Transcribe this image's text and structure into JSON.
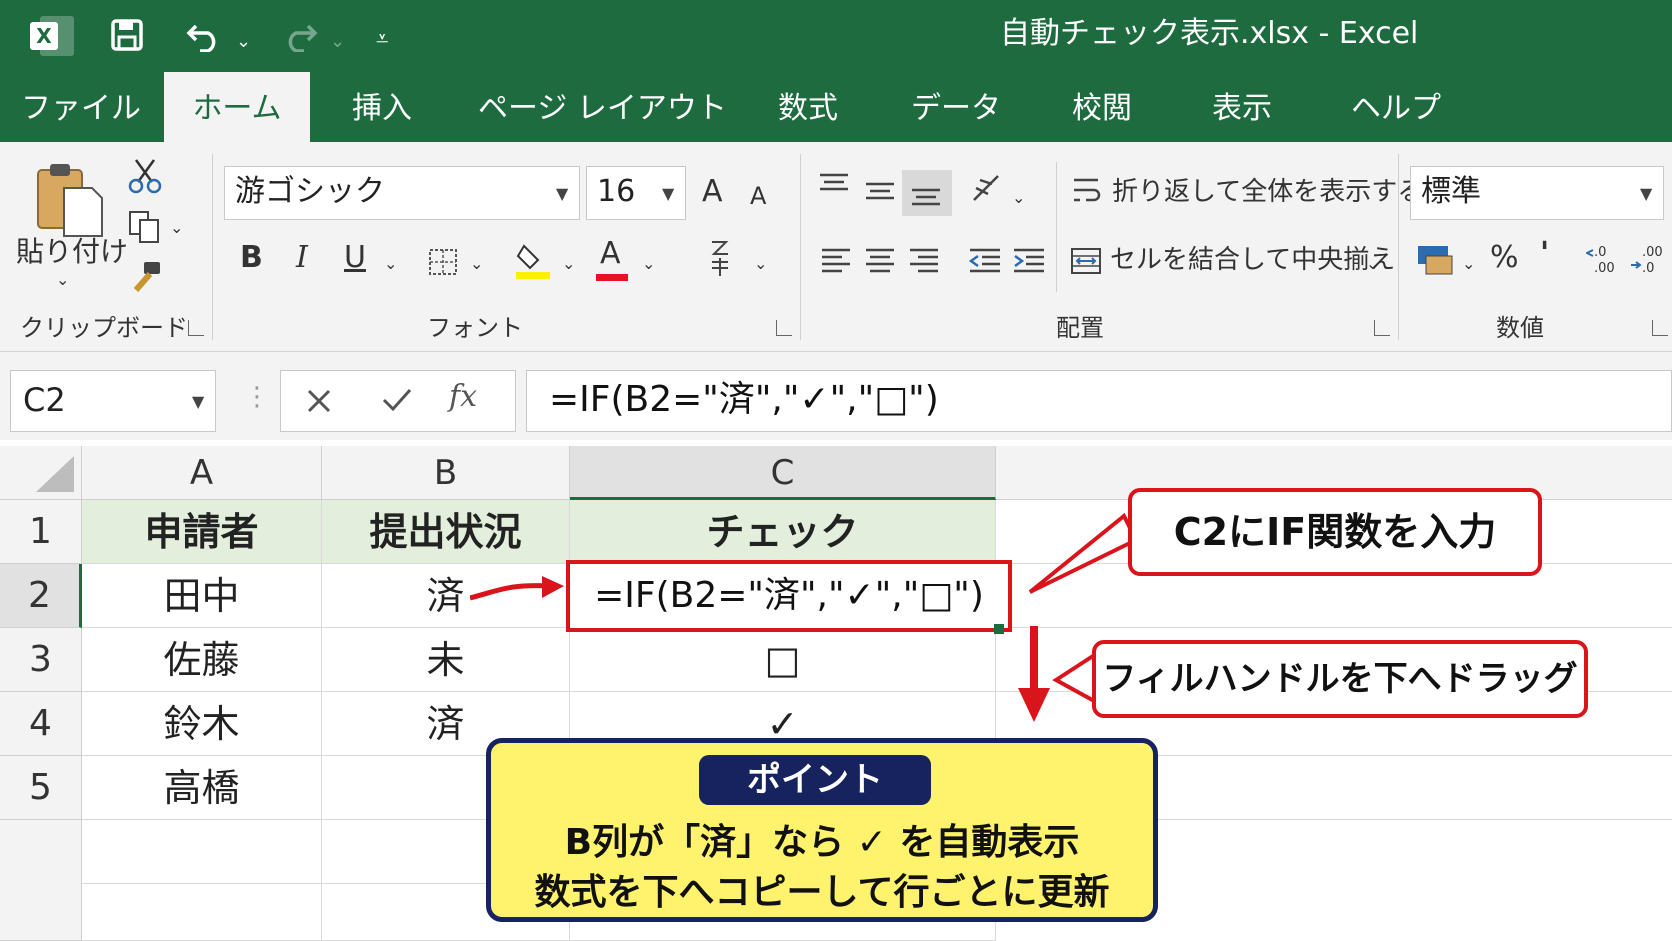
{
  "titlebar": {
    "title": "自動チェック表示.xlsx  -  Excel",
    "app_icon": "X",
    "accent": "#1e6b40"
  },
  "tabs": [
    "ファイル",
    "ホーム",
    "挿入",
    "ページ レイアウト",
    "数式",
    "データ",
    "校閲",
    "表示",
    "ヘルプ"
  ],
  "ribbon": {
    "clipboard": {
      "paste_label": "貼り付け",
      "group_label": "クリップボード"
    },
    "font": {
      "font_name": "游ゴシック",
      "font_size": "16",
      "grow": "A",
      "shrink": "A",
      "bold": "B",
      "italic": "I",
      "underline": "U",
      "font_color": "A",
      "group_label": "フォント"
    },
    "alignment": {
      "wrap_text": "折り返して全体を表示する",
      "merge_center": "セルを結合して中央揃え",
      "group_label": "配置"
    },
    "number": {
      "format": "標準",
      "percent": "%",
      "comma": "'",
      "group_label": "数値"
    }
  },
  "formula_bar": {
    "name_box": "C2",
    "fx": "fx",
    "formula": "=IF(B2=\"済\",\"✓\",\"□\")"
  },
  "grid": {
    "columns": [
      "A",
      "B",
      "C"
    ],
    "rows": [
      "1",
      "2",
      "3",
      "4",
      "5"
    ],
    "header": [
      "申請者",
      "提出状況",
      "チェック"
    ],
    "data": [
      [
        "田中",
        "済",
        "=IF(B2=\"済\",\"✓\",\"□\")"
      ],
      [
        "佐藤",
        "未",
        "□"
      ],
      [
        "鈴木",
        "済",
        "✓"
      ],
      [
        "高橋",
        "",
        ""
      ]
    ]
  },
  "callouts": {
    "input": "C2にIF関数を入力",
    "drag": "フィルハンドルを下へドラッグ"
  },
  "point": {
    "title": "ポイント",
    "line1": "B列が「済」なら ✓ を自動表示",
    "line2": "数式を下へコピーして行ごとに更新"
  },
  "colors": {
    "callout_red": "#d9141b",
    "point_yellow": "#fff36e",
    "point_navy": "#16235e",
    "header_green": "#e3efdc"
  }
}
